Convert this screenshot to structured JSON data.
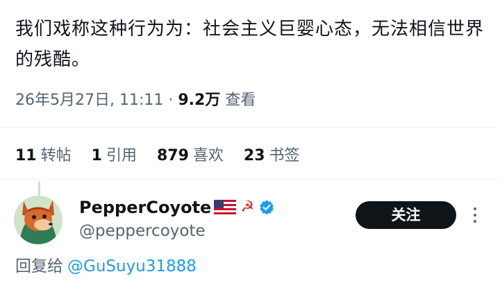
{
  "tweet": {
    "text": "我们戏称这种行为为：社会主义巨婴心态，无法相信世界的残酷。",
    "date_time": "26年5月27日, 11:11 · ",
    "views_count": "9.2万",
    "views_label": " 查看"
  },
  "stats": [
    {
      "count": "11",
      "label": "转帖"
    },
    {
      "count": "1",
      "label": "引用"
    },
    {
      "count": "879",
      "label": "喜欢"
    },
    {
      "count": "23",
      "label": "书签"
    }
  ],
  "reply": {
    "display_name": "PepperCoyote",
    "symbol": "☭",
    "handle": "@peppercoyote",
    "follow_label": "关注",
    "reply_to_label": "回复给",
    "reply_to_handle": "@GuSuyu31888"
  },
  "colors": {
    "text": "#0f1419",
    "secondary": "#536471",
    "link": "#1d9bf0",
    "button_bg": "#0f1419",
    "verified": "#1d9bf0"
  },
  "icons": [
    "us-flag-icon",
    "hammer-sickle-icon",
    "verified-badge-icon",
    "more-options-icon"
  ]
}
